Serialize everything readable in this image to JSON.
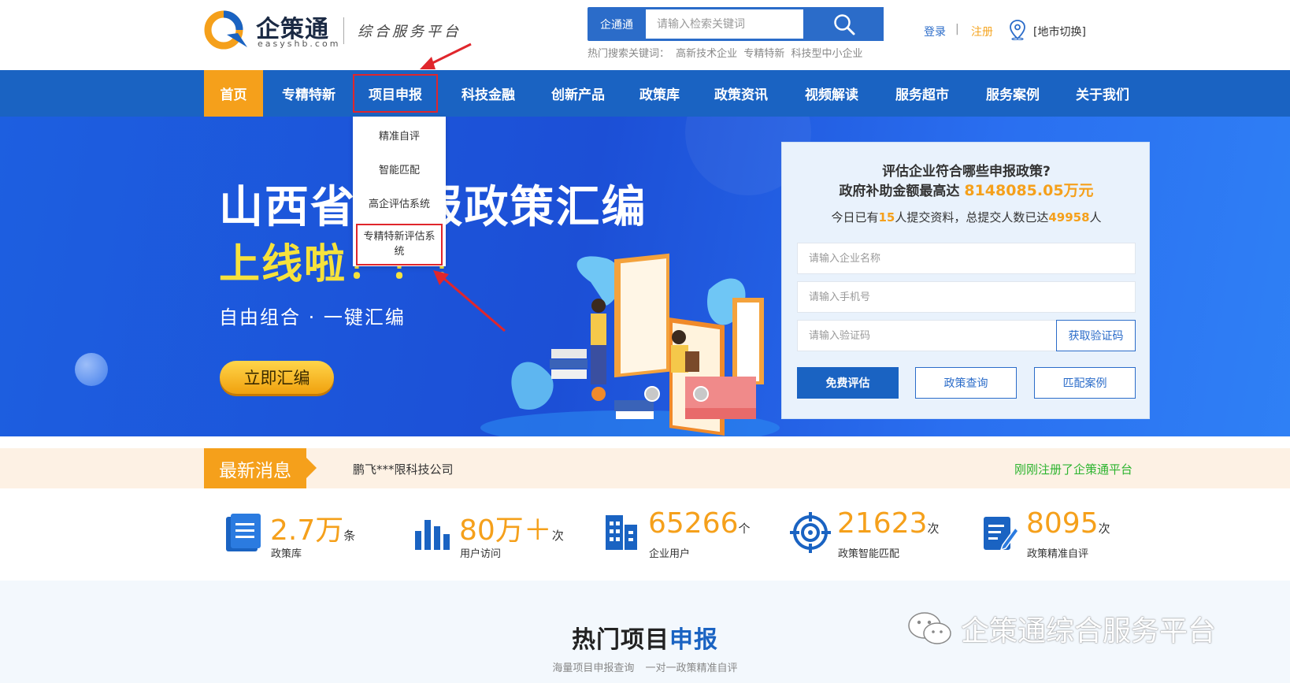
{
  "header": {
    "logo_text": "企策通",
    "logo_domain": "easyshb.com",
    "slogan": "综合服务平台",
    "search": {
      "category": "企通通",
      "placeholder": "请输入检索关键词"
    },
    "hot_label": "热门搜索关键词：",
    "hot_keywords": [
      "高新技术企业",
      "专精特新",
      "科技型中小企业"
    ],
    "login": "登录",
    "separator": "|",
    "register": "注册",
    "city": "[地市切换]"
  },
  "nav": {
    "items": [
      "首页",
      "专精特新",
      "项目申报",
      "科技金融",
      "创新产品",
      "政策库",
      "政策资讯",
      "视频解读",
      "服务超市",
      "服务案例",
      "关于我们"
    ],
    "active_index": 0,
    "highlighted_index": 2
  },
  "dropdown": {
    "items": [
      "精准自评",
      "智能匹配",
      "高企评估系统",
      "专精特新评估系统"
    ],
    "highlighted_index": 3
  },
  "banner": {
    "title": "山西省       申报政策汇编",
    "subtitle": "上线啦！！！",
    "tagline": "自由组合  ·  一键汇编",
    "cta": "立即汇编"
  },
  "form": {
    "question": "评估企业符合哪些申报政策?",
    "subsidy_prefix": "政府补助金额最高达",
    "subsidy_amount": "8148085.05万元",
    "stat_prefix": "今日已有",
    "today_count": "15",
    "stat_middle": "人提交资料，总提交人数已达",
    "total_count": "49958",
    "stat_suffix": "人",
    "company_placeholder": "请输入企业名称",
    "phone_placeholder": "请输入手机号",
    "code_placeholder": "请输入验证码",
    "get_code": "获取验证码",
    "buttons": [
      "免费评估",
      "政策查询",
      "匹配案例"
    ]
  },
  "news": {
    "tag": "最新消息",
    "company": "鹏飞***限科技公司",
    "action": "刚刚注册了企策通平台"
  },
  "stats": [
    {
      "value": "2.7万",
      "unit": "条",
      "label": "政策库",
      "icon": "document-list-icon"
    },
    {
      "value": "80万＋",
      "unit": "次",
      "label": "用户访问",
      "icon": "bar-chart-icon"
    },
    {
      "value": "65266",
      "unit": "个",
      "label": "企业用户",
      "icon": "building-icon"
    },
    {
      "value": "21623",
      "unit": "次",
      "label": "政策智能匹配",
      "icon": "target-icon"
    },
    {
      "value": "8095",
      "unit": "次",
      "label": "政策精准自评",
      "icon": "edit-form-icon"
    }
  ],
  "hot_section": {
    "title_black": "热门项目",
    "title_blue": "申报",
    "subtitle": "海量项目申报查询  一对一政策精准自评"
  },
  "watermark": "企策通综合服务平台",
  "colors": {
    "brand_blue": "#1a63c2",
    "accent_orange": "#f5a01b",
    "highlight_red": "#e0262c",
    "success_green": "#2db42f"
  }
}
